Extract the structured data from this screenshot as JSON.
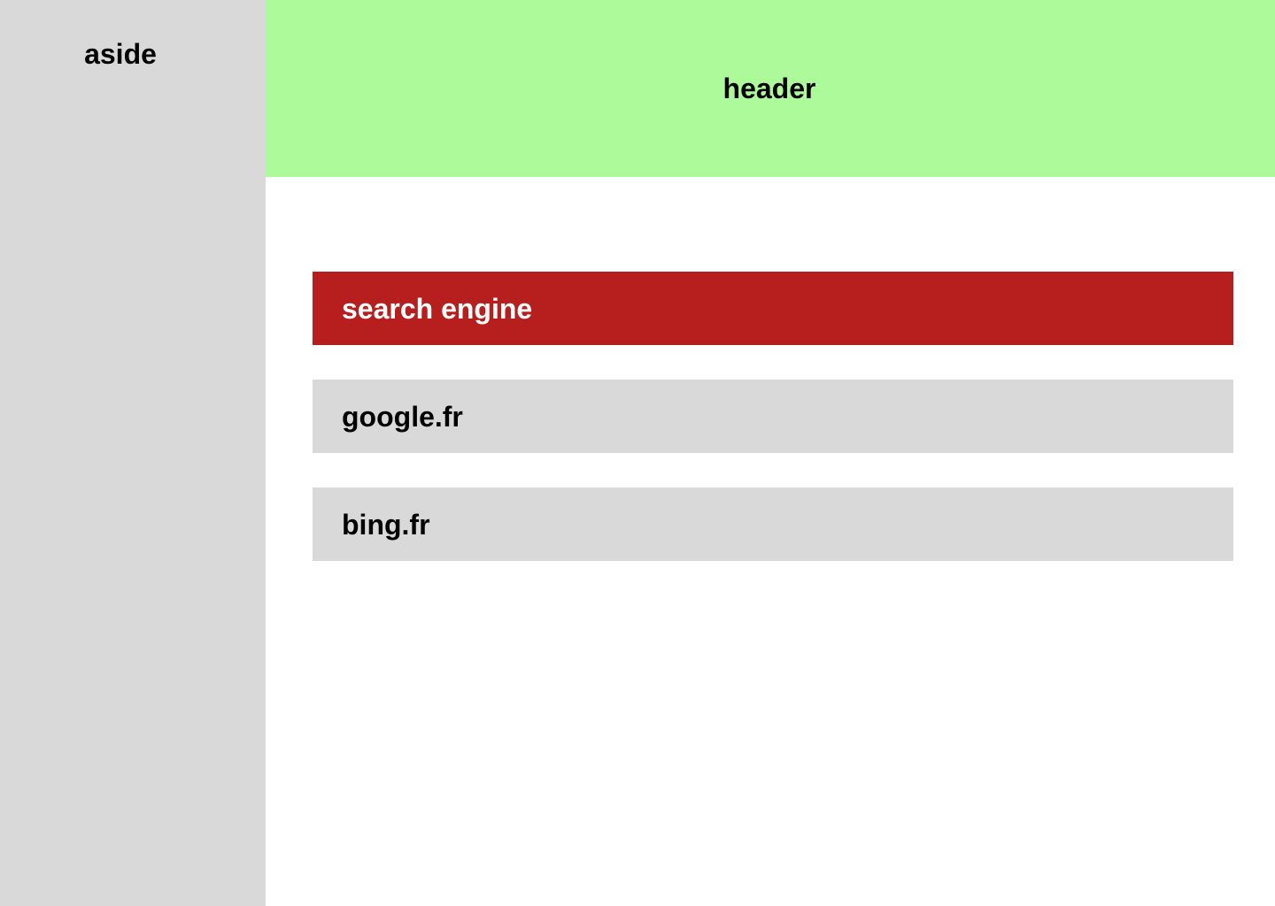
{
  "aside": {
    "title": "aside"
  },
  "header": {
    "title": "header"
  },
  "main": {
    "list_heading": "search engine",
    "items": [
      {
        "label": "google.fr"
      },
      {
        "label": "bing.fr"
      }
    ]
  },
  "colors": {
    "aside_bg": "#d9d9d9",
    "header_bg": "#adfa9a",
    "heading_bg": "#b71f1f",
    "item_bg": "#d9d9d9"
  }
}
